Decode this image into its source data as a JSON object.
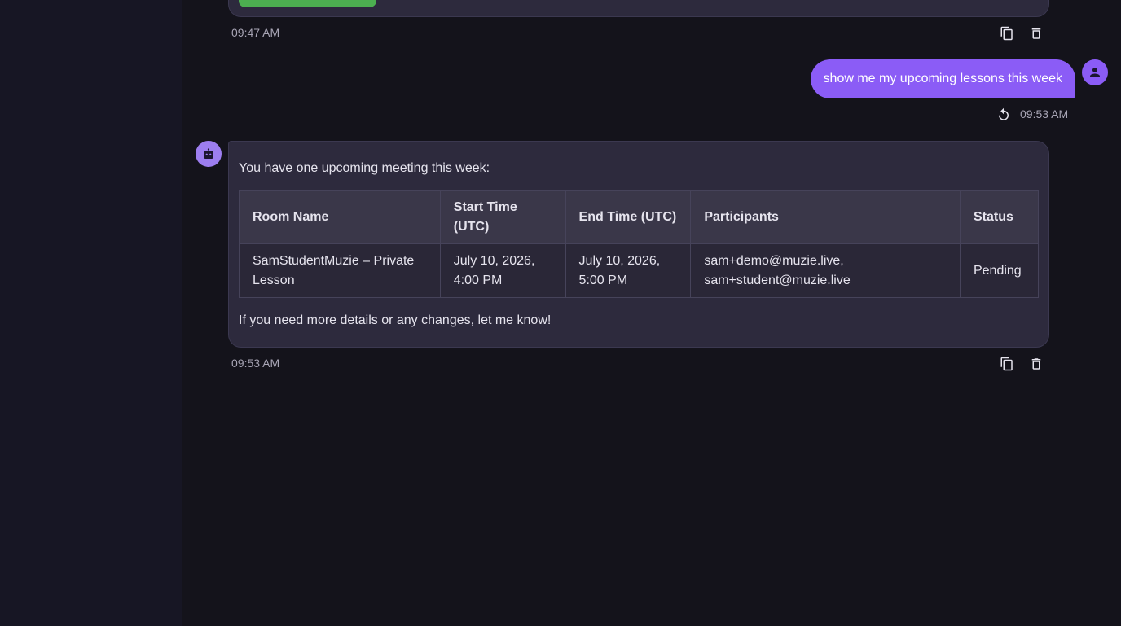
{
  "previous_message": {
    "time": "09:47 AM"
  },
  "user_message": {
    "text": "show me my upcoming lessons this week",
    "time": "09:53 AM"
  },
  "assistant_message": {
    "intro": "You have one upcoming meeting this week:",
    "table": {
      "headers": [
        "Room Name",
        "Start Time (UTC)",
        "End Time (UTC)",
        "Participants",
        "Status"
      ],
      "rows": [
        [
          "SamStudentMuzie – Private Lesson",
          "July 10, 2026, 4:00 PM",
          "July 10, 2026, 5:00 PM",
          "sam+demo@muzie.live, sam+student@muzie.live",
          "Pending"
        ]
      ]
    },
    "outro": "If you need more details or any changes, let me know!",
    "time": "09:53 AM"
  },
  "icons": {
    "copy": "copy-icon",
    "delete": "trash-icon",
    "retry": "refresh-icon",
    "user_avatar": "person-icon",
    "bot_avatar": "robot-icon"
  },
  "colors": {
    "accent": "#8b5cf6",
    "background": "#14131b",
    "bubble": "#2d2a3d",
    "success": "#4caf50"
  }
}
